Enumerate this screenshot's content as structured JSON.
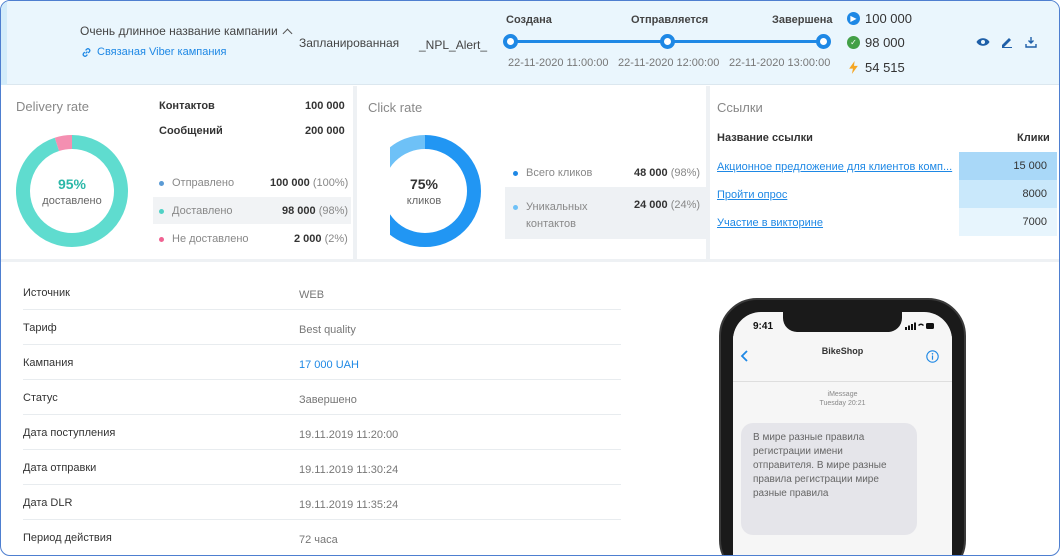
{
  "header": {
    "campaign_title": "Очень длинное название кампании",
    "linked_campaign": "Связаная Viber кампания",
    "status": "Запланированная",
    "alpha_name": "_NPL_Alert_",
    "timeline": [
      {
        "label": "Создана",
        "date": "22-11-2020 11:00:00"
      },
      {
        "label": "Отправляется",
        "date": "22-11-2020 12:00:00"
      },
      {
        "label": "Завершена",
        "date": "22-11-2020 13:00:00"
      }
    ],
    "metrics": [
      {
        "icon": "send-icon",
        "value": "100 000",
        "color": "#1e88e5"
      },
      {
        "icon": "check-circle-icon",
        "value": "98 000",
        "color": "#43a047"
      },
      {
        "icon": "lightning-icon",
        "value": "54 515",
        "color": "#f5a623"
      }
    ]
  },
  "delivery": {
    "title": "Delivery rate",
    "center_pct": "95%",
    "center_sub": "доставлено",
    "contacts_label": "Контактов",
    "contacts_value": "100 000",
    "messages_label": "Сообщений",
    "messages_value": "200 000",
    "legend": [
      {
        "label": "Отправлено",
        "value": "100 000",
        "pct": "(100%)",
        "color": "#5b9bd5"
      },
      {
        "label": "Доставлено",
        "value": "98 000",
        "pct": "(98%)",
        "color": "#4fd1c5"
      },
      {
        "label": "Не доставлено",
        "value": "2 000",
        "pct": "(2%)",
        "color": "#f06292"
      }
    ],
    "donut_share": 0.95,
    "colors": {
      "main": "#5fdccf",
      "rest": "#f48fb1"
    }
  },
  "clicks": {
    "title": "Click rate",
    "center_pct": "75%",
    "center_sub": "кликов",
    "donut_share": 0.75,
    "colors": {
      "main": "#2196f3",
      "rest": "#6ec1f7"
    },
    "legend": [
      {
        "label": "Всего кликов",
        "value": "48 000",
        "pct": "(98%)",
        "color": "#1e88e5"
      },
      {
        "label_line1": "Уникальных",
        "label_line2": "контактов",
        "value": "24 000",
        "pct": "(24%)",
        "color": "#6ec1f7"
      }
    ]
  },
  "links": {
    "title": "Ссылки",
    "col_name": "Название ссылки",
    "col_clicks": "Клики",
    "rows": [
      {
        "name": "Акционное предложение для клиентов комп...",
        "clicks": "15 000",
        "bg": "#a9d8f8"
      },
      {
        "name": "Пройти опрос",
        "clicks": "8000",
        "bg": "#c9e8fb"
      },
      {
        "name": "Участие в викторине",
        "clicks": "7000",
        "bg": "#e7f5fd"
      }
    ]
  },
  "details": [
    {
      "label": "Источник",
      "value": "WEB"
    },
    {
      "label": "Тариф",
      "value": "Best quality"
    },
    {
      "label": "Кампания",
      "value": "17 000 UAH",
      "link": true
    },
    {
      "label": "Статус",
      "value": "Завершено"
    },
    {
      "label": "Дата поступления",
      "value": "19.11.2019 11:20:00"
    },
    {
      "label": "Дата отправки",
      "value": "19.11.2019 11:30:24"
    },
    {
      "label": "Дата DLR",
      "value": "19.11.2019 11:35:24"
    },
    {
      "label": "Период действия",
      "value": "72 часа"
    }
  ],
  "phone": {
    "time": "9:41",
    "contact": "BikeShop",
    "service": "iMessage",
    "stamp": "Tuesday 20:21",
    "message": "В мире разные правила регистрации имени отправителя. В мире разные правила регистрации мире разные правила"
  }
}
